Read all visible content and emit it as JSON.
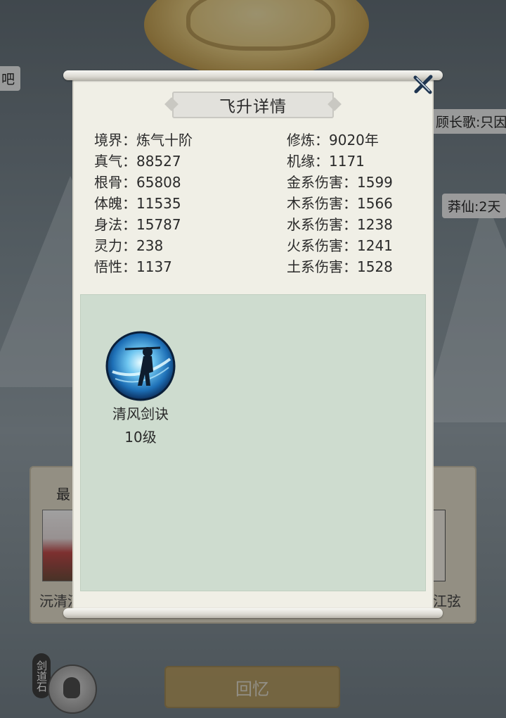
{
  "background": {
    "chat_left": "吧",
    "chat_right_1": "顾长歌:只因",
    "chat_right_2": "莽仙:2天",
    "card_title": "最",
    "card_name_left": "沅清河",
    "card_name_right": "江弦",
    "stone_label": "剑道石",
    "recall_button": "回忆"
  },
  "panel": {
    "title": "飞升详情",
    "close_icon": "close-x-icon",
    "stats_left": [
      {
        "label": "境界：",
        "value": "炼气十阶"
      },
      {
        "label": "真气：",
        "value": "88527"
      },
      {
        "label": "根骨：",
        "value": "65808"
      },
      {
        "label": "体魄：",
        "value": "11535"
      },
      {
        "label": "身法：",
        "value": "15787"
      },
      {
        "label": "灵力：",
        "value": "238"
      },
      {
        "label": "悟性：",
        "value": "1137"
      }
    ],
    "stats_right": [
      {
        "label": "修炼：",
        "value": "9020年"
      },
      {
        "label": "机缘：",
        "value": "1171"
      },
      {
        "label": "金系伤害：",
        "value": "1599"
      },
      {
        "label": "木系伤害：",
        "value": "1566"
      },
      {
        "label": "水系伤害：",
        "value": "1238"
      },
      {
        "label": "火系伤害：",
        "value": "1241"
      },
      {
        "label": "土系伤害：",
        "value": "1528"
      }
    ],
    "skills": [
      {
        "name": "清风剑诀",
        "level": "10级",
        "icon": "wind-sword-skill-icon"
      }
    ]
  },
  "colors": {
    "scroll_paper": "#f0efe6",
    "skill_area": "#cedccf",
    "recall_button": "#b79a5b",
    "title_plate": "#e2e1dc"
  }
}
